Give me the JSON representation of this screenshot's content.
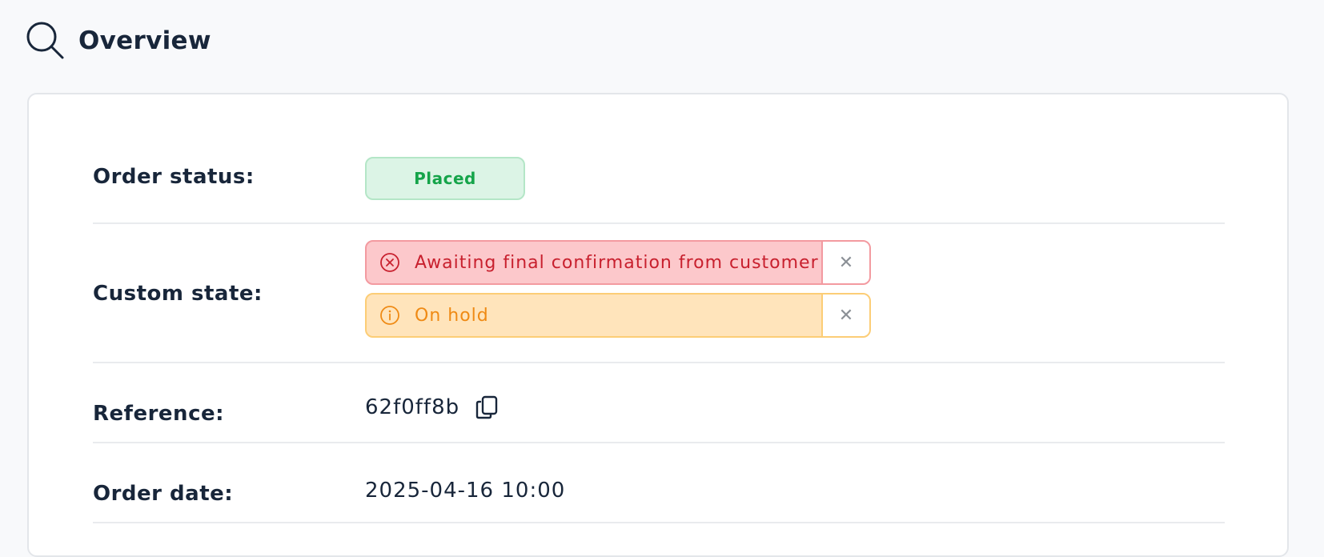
{
  "header": {
    "title": "Overview",
    "icon": "search-icon"
  },
  "overview": {
    "rows": [
      {
        "label": "Order status:",
        "value": "Placed"
      },
      {
        "label": "Custom state:"
      },
      {
        "label": "Reference:",
        "value": "62f0ff8b"
      },
      {
        "label": "Order date:",
        "value": "2025-04-16 10:00"
      }
    ],
    "custom_states": [
      {
        "text": "Awaiting final confirmation from customer",
        "icon": "error-circle-icon",
        "remove_label": "✕",
        "color": "#c8202e"
      },
      {
        "text": "On hold",
        "icon": "info-circle-icon",
        "remove_label": "✕",
        "color": "#ef8a14"
      }
    ],
    "status_color": "#15a44a"
  }
}
